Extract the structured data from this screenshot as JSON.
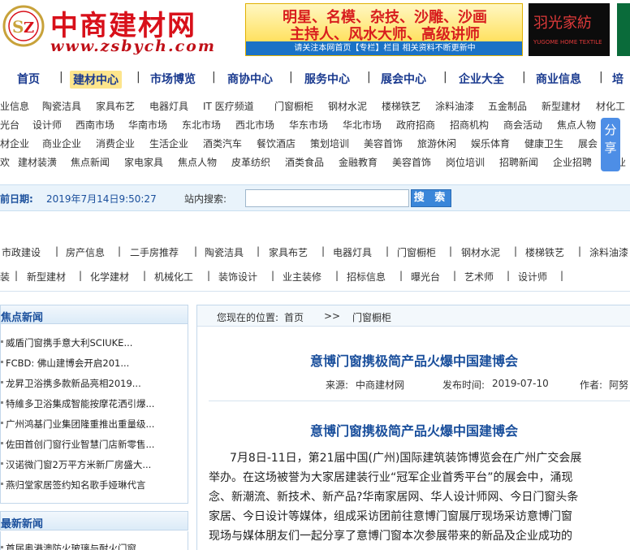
{
  "header": {
    "logo_title": "中商建材网",
    "logo_url": "www.zsbych.com",
    "ad_line1": "明星、名模、杂技、沙雕、沙画",
    "ad_line2": "主持人、风水大师、高级讲师",
    "ad_footer": "请关注本网首页【专栏】栏目  相关资料不断更新中",
    "brand_ad_cn": "羽光家紡",
    "brand_ad_en": "YUGOME HOME TEXTILE"
  },
  "main_nav": [
    "首页",
    "建材中心",
    "市场博览",
    "商协中心",
    "服务中心",
    "展会中心",
    "企业大全",
    "商业信息",
    "培"
  ],
  "category_rows": [
    [
      "业信息",
      "陶瓷洁具",
      "家具布艺",
      "电器灯具",
      "IT 医疗频道",
      "门窗橱柜",
      "钢材水泥",
      "楼梯铁艺",
      "涂料油漆",
      "五金制品",
      "新型建材",
      "材化工"
    ],
    [
      "光台",
      "设计师",
      "西南市场",
      "华南市场",
      "东北市场",
      "西北市场",
      "华东市场",
      "华北市场",
      "政府招商",
      "招商机构",
      "商会活动",
      "焦点人物"
    ],
    [
      "材企业",
      "商业企业",
      "消费企业",
      "生活企业",
      "酒类汽车",
      "餐饮酒店",
      "策划培训",
      "美容首饰",
      "旅游休闲",
      "娱乐体育",
      "健康卫生",
      "展会"
    ],
    [
      "欢",
      "建材装潢",
      "焦点新闻",
      "家电家具",
      "焦点人物",
      "皮革纺织",
      "酒类食品",
      "金融教育",
      "美容首饰",
      "岗位培训",
      "招聘新闻",
      "企业招聘",
      "企业"
    ]
  ],
  "share_label": "分享",
  "search_bar": {
    "date_label": "前日期:",
    "date_value": "2019年7月14日9:50:27",
    "search_label": "站内搜索:",
    "search_placeholder": "",
    "search_button": "搜 索"
  },
  "sub_nav_rows": [
    [
      "市政建设",
      "房产信息",
      "二手房推荐",
      "陶瓷洁具",
      "家具布艺",
      "电器灯具",
      "门窗橱柜",
      "钢材水泥",
      "楼梯铁艺",
      "涂料油漆"
    ],
    [
      "装",
      "新型建材",
      "化学建材",
      "机械化工",
      "装饰设计",
      "业主装修",
      "招标信息",
      "曝光台",
      "艺术师",
      "设计师"
    ]
  ],
  "focus_news": {
    "title": "焦点新闻",
    "items": [
      "威盾门窗携手意大利SCIUKE...",
      "FCBD: 佛山建博会开启201...",
      "龙昇卫浴携多款新品亮相2019...",
      "特維多卫浴集成智能按摩花洒引爆...",
      "广州鸿基门业集团隆重推出重量级...",
      "佐田首创门窗行业智慧门店新零售...",
      "汉诺微门窗2万平方米新厂房盛大...",
      "燕归堂家居签约知名歌手娅琳代言"
    ]
  },
  "latest_news": {
    "title": "最新新闻",
    "items": [
      "首届奥港澳防火玻璃与耐火门窗..."
    ]
  },
  "article": {
    "crumb_prefix": "您现在的位置:",
    "crumb_home": "首页",
    "crumb_sep": ">>",
    "crumb_current": "门窗橱柜",
    "title": "意博门窗携极简产品火爆中国建博会",
    "source_label": "来源:",
    "source_value": "中商建材网",
    "time_label": "发布时间:",
    "time_value": "2019-07-10",
    "author_label": "作者:",
    "author_value": "阿努",
    "body_title": "意博门窗携极简产品火爆中国建博会",
    "body_lines": [
      "7月8日-11日，第21届中国(广州)国际建筑装饰博览会在广州广交会展",
      "举办。在这场被誉为大家居建装行业“冠军企业首秀平台”的展会中，涌现",
      "念、新潮流、新技术、新产品?华南家居网、华人设计师网、今日门窗头条",
      "家居、今日设计等媒体，组成采访团前往意博门窗展厅现场采访意博门窗",
      "现场与媒体朋友们一起分享了意博门窗本次参展带来的新品及企业成功的"
    ]
  },
  "colors": {
    "brand_red": "#d8101a",
    "nav_blue": "#1a3a8f",
    "link_blue": "#1a4f9c",
    "active_nav_bg": "#fde58c",
    "search_button_bg": "#3a86d9",
    "share_bg": "#4d8ee6"
  }
}
